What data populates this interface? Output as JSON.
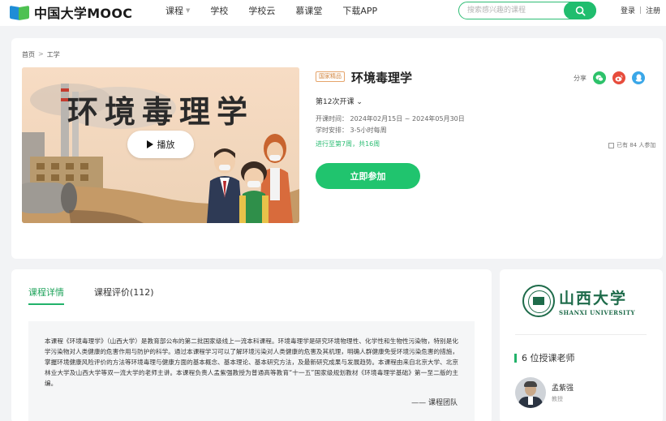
{
  "brand": {
    "logo_text": "中国大学MOOC"
  },
  "nav": {
    "items": [
      {
        "label": "课程",
        "has_caret": true
      },
      {
        "label": "学校"
      },
      {
        "label": "学校云"
      },
      {
        "label": "慕课堂"
      },
      {
        "label": "下载APP"
      }
    ]
  },
  "search": {
    "placeholder": "搜索感兴趣的课程"
  },
  "auth": {
    "login": "登录",
    "separator": "|",
    "register": "注册"
  },
  "breadcrumb": {
    "home": "首页",
    "separator": ">",
    "category": "工学"
  },
  "cover": {
    "title": "环境毒理学",
    "play_label": "播放"
  },
  "course": {
    "tag": "国家精品",
    "name": "环境毒理学",
    "session": "第12次开课",
    "session_caret": "⌄",
    "schedule_label": "开课时间：",
    "schedule_value": "2024年02月15日 ~ 2024年05月30日",
    "workload_label": "学时安排：",
    "workload_value": "3-5小时每周",
    "progress": "进行至第7周，共16周",
    "participants": "已有 84 人参加",
    "join_label": "立即参加"
  },
  "share": {
    "label": "分享"
  },
  "detail": {
    "tabs": [
      {
        "label": "课程详情",
        "active": true
      },
      {
        "label": "课程评价(112)",
        "active": false
      }
    ],
    "intro": "本课程《环境毒理学》（山西大学）是教育部公布的第二批国家级线上一流本科课程。环境毒理学是研究环境物理性、化学性和生物性污染物，特别是化学污染物对人类健康的危害作用与防护的科学。通过本课程学习可以了解环境污染对人类健康的危害及其机理，明确人群健康免受环境污染危害的措施，掌握环境健康风险评价的方法等环境毒理与健康方面的基本概念、基本理论、基本研究方法，及最新研究成果与发展趋势。本课程由来自北京大学、北京林业大学及山西大学等双一流大学的老师主讲。本课程负责人孟紫强教授为普通高等教育“十一五”国家级规划教材《环境毒理学基础》第一至二版的主编。",
    "signature": "—— 课程团队"
  },
  "school": {
    "name_cn": "山西大学",
    "name_en": "SHANXI UNIVERSITY"
  },
  "teachers": {
    "title": "6 位授课老师",
    "list": [
      {
        "name": "孟紫强",
        "title": "教授"
      }
    ]
  },
  "colors": {
    "accent": "#20c46e",
    "school_green": "#1e6b4a",
    "tag_orange": "#d1843e"
  }
}
